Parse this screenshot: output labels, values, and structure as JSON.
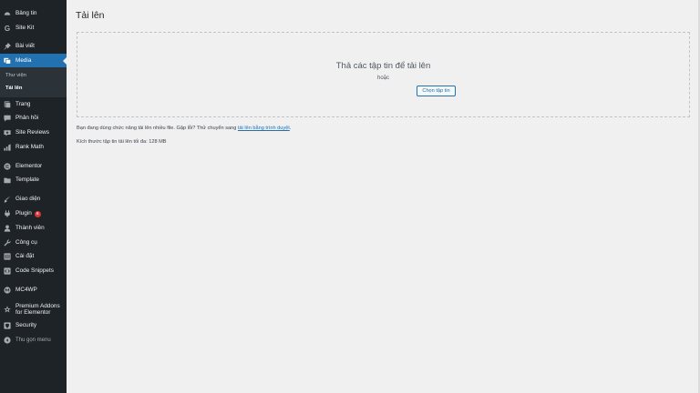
{
  "sidebar": {
    "items": [
      {
        "label": "Bảng tin",
        "icon": "dashboard-icon"
      },
      {
        "label": "Site Kit",
        "icon": "sitekit-icon"
      },
      {
        "label": "Bài viết",
        "icon": "pin-icon"
      },
      {
        "label": "Media",
        "icon": "media-icon"
      },
      {
        "label": "Trang",
        "icon": "page-icon"
      },
      {
        "label": "Phản hồi",
        "icon": "comment-icon"
      },
      {
        "label": "Site Reviews",
        "icon": "star-icon"
      },
      {
        "label": "Rank Math",
        "icon": "chart-icon"
      },
      {
        "label": "Elementor",
        "icon": "elementor-icon"
      },
      {
        "label": "Template",
        "icon": "folder-icon"
      },
      {
        "label": "Giao diện",
        "icon": "brush-icon"
      },
      {
        "label": "Plugin",
        "icon": "plugin-icon",
        "badge": "6"
      },
      {
        "label": "Thành viên",
        "icon": "user-icon"
      },
      {
        "label": "Công cụ",
        "icon": "wrench-icon"
      },
      {
        "label": "Cài đặt",
        "icon": "settings-icon"
      },
      {
        "label": "Code Snippets",
        "icon": "code-icon"
      },
      {
        "label": "MC4WP",
        "icon": "mc4wp-icon"
      },
      {
        "label": "Premium Addons for Elementor",
        "icon": "addons-icon"
      },
      {
        "label": "Security",
        "icon": "shield-icon"
      }
    ],
    "submenu": {
      "library": "Thư viện",
      "upload": "Tải lên"
    },
    "collapse_label": "Thu gọn menu"
  },
  "main": {
    "title": "Tải lên",
    "dropzone_title": "Thả các tập tin để tải lên",
    "or_text": "hoặc",
    "select_button": "Chọn tập tin",
    "notice_text": "Bạn đang dùng chức năng tải lên nhiều file. Gặp lỗi? Thử chuyển sang",
    "notice_link": "tải lên bằng trình duyệt",
    "notice_end": ".",
    "max_size": "Kích thước tập tin tải lên tối đa: 128 MB"
  },
  "colors": {
    "sidebar_bg": "#1d2327",
    "accent": "#2271b1",
    "page_bg": "#f0f0f1",
    "badge": "#d63638"
  }
}
